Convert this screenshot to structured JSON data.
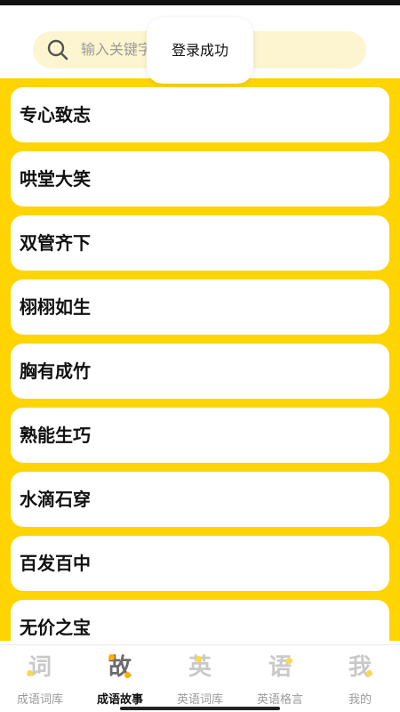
{
  "search": {
    "placeholder": "输入关键字",
    "icon": "search-icon"
  },
  "toast": {
    "message": "登录成功"
  },
  "idioms": [
    {
      "label": "专心致志"
    },
    {
      "label": "哄堂大笑"
    },
    {
      "label": "双管齐下"
    },
    {
      "label": "栩栩如生"
    },
    {
      "label": "胸有成竹"
    },
    {
      "label": "熟能生巧"
    },
    {
      "label": "水滴石穿"
    },
    {
      "label": "百发百中"
    },
    {
      "label": "无价之宝"
    }
  ],
  "tabbar": {
    "active_index": 1,
    "tabs": [
      {
        "label": "成语词库",
        "glyph": "词",
        "icon": "idiom-dictionary-icon"
      },
      {
        "label": "成语故事",
        "glyph": "故",
        "icon": "idiom-story-icon"
      },
      {
        "label": "英语词库",
        "glyph": "英",
        "icon": "english-dictionary-icon"
      },
      {
        "label": "英语格言",
        "glyph": "语",
        "icon": "english-quotes-icon"
      },
      {
        "label": "我的",
        "glyph": "我",
        "icon": "profile-icon"
      }
    ]
  },
  "colors": {
    "accent": "#ffd400",
    "search_bg": "#fdf5cf",
    "tab_dot": "#ffc400",
    "active_dot": "#ffb000"
  }
}
